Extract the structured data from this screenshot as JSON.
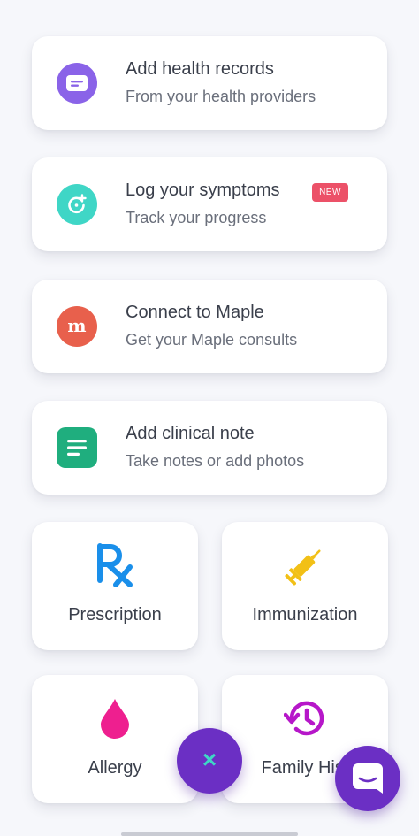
{
  "cards": {
    "health_records": {
      "title": "Add health records",
      "subtitle": "From your health providers",
      "icon": "record-card-icon",
      "color": "#8a63e8"
    },
    "symptoms": {
      "title": "Log your symptoms",
      "subtitle": "Track your progress",
      "badge": "NEW",
      "icon": "symptom-tracker-icon",
      "color": "#3fd6c6"
    },
    "maple": {
      "title": "Connect to Maple",
      "subtitle": "Get your Maple consults",
      "icon_glyph": "m",
      "icon": "maple-logo-icon",
      "color": "#e8604c"
    },
    "clinical_note": {
      "title": "Add clinical note",
      "subtitle": "Take notes or add photos",
      "icon": "note-icon",
      "color": "#1fae7e"
    }
  },
  "tiles": {
    "prescription": {
      "label": "Prescription",
      "icon": "rx-icon",
      "color": "#1a8fea"
    },
    "immunization": {
      "label": "Immunization",
      "icon": "syringe-icon",
      "color": "#f2c016"
    },
    "allergy": {
      "label": "Allergy",
      "icon": "drop-icon",
      "color": "#ee1f8f"
    },
    "family_history": {
      "label": "Family Hist",
      "icon": "history-icon",
      "color": "#b617c9"
    }
  },
  "fab": {
    "glyph": "×",
    "icon": "close-icon",
    "color": "#6b2fc4",
    "accent": "#3fd6c6"
  },
  "chat": {
    "icon": "chat-icon",
    "color": "#6b2fc4"
  }
}
